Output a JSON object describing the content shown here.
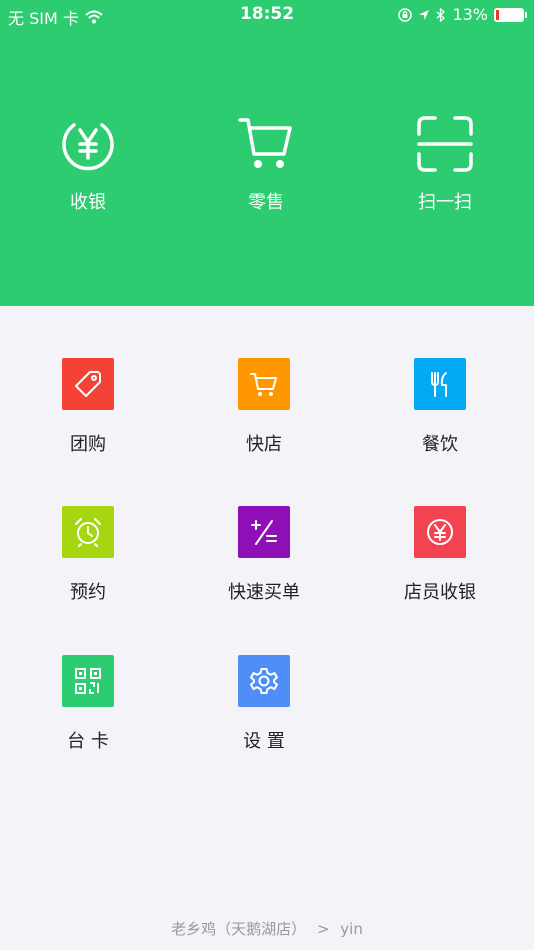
{
  "status": {
    "carrier": "无 SIM 卡",
    "time": "18:52",
    "battery_percent": "13%",
    "battery_level": 0.13
  },
  "hero": {
    "items": [
      {
        "label": "收银",
        "icon": "yen-circle-icon"
      },
      {
        "label": "零售",
        "icon": "cart-icon"
      },
      {
        "label": "扫一扫",
        "icon": "scan-icon"
      }
    ]
  },
  "grid": {
    "items": [
      {
        "label": "团购",
        "icon": "tag-icon",
        "color": "#f44336"
      },
      {
        "label": "快店",
        "icon": "cart-icon",
        "color": "#ff9800"
      },
      {
        "label": "餐饮",
        "icon": "fork-knife-icon",
        "color": "#03a9f4"
      },
      {
        "label": "预约",
        "icon": "alarm-clock-icon",
        "color": "#a5d610"
      },
      {
        "label": "快速买单",
        "icon": "calculator-icon",
        "color": "#8e0fb5"
      },
      {
        "label": "店员收银",
        "icon": "yen-circle-icon",
        "color": "#f44350"
      },
      {
        "label": "台 卡",
        "icon": "qr-code-icon",
        "color": "#2ecc71"
      },
      {
        "label": "设 置",
        "icon": "gear-icon",
        "color": "#4f8ef7"
      }
    ]
  },
  "footer": {
    "store": "老乡鸡（天鹅湖店）",
    "separator": ">",
    "user": "yin"
  }
}
